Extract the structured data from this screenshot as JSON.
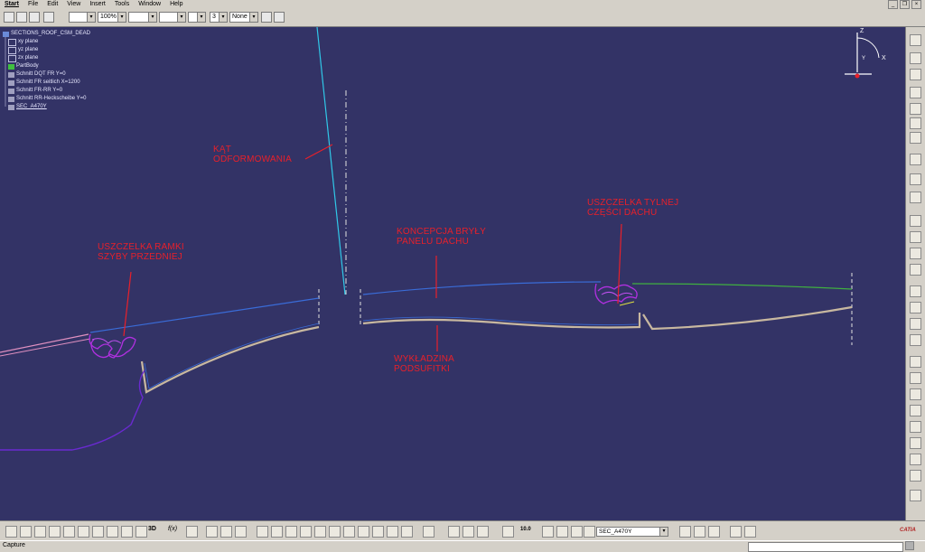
{
  "menu": [
    "Start",
    "File",
    "Edit",
    "View",
    "Insert",
    "Tools",
    "Window",
    "Help"
  ],
  "toolbar": {
    "line_style_value": "",
    "zoom_value": "100%",
    "line_type_value": "",
    "line_thickness_value": "",
    "point_style_value": "",
    "layer_number_value": "3",
    "layer_value": "None"
  },
  "tree": {
    "root": "SECTIONS_ROOF_CSM_DEAD",
    "items": [
      "xy plane",
      "yz plane",
      "zx plane",
      "PartBody",
      "Schnitt DQT FR Y=0",
      "Schnitt FR seitlich X=1200",
      "Schnitt FR-RR Y=0",
      "Schnitt RR-Heckscheibe Y=0",
      "SEC_A470Y"
    ]
  },
  "annotations": {
    "kat": [
      "KĄT",
      "ODFORMOWANIA"
    ],
    "uszczelka_ramki": [
      "USZCZELKA RAMKI",
      "SZYBY PRZEDNIEJ"
    ],
    "koncepcja": [
      "KONCEPCJA BRYŁY",
      "PANELU DACHU"
    ],
    "uszczelka_tylnej": [
      "USZCZELKA TYLNEJ",
      "CZĘŚCI DACHU"
    ],
    "wykladzina": [
      "WYKŁADZINA",
      "PODSUFITKI"
    ]
  },
  "compass": {
    "z_label": "Z",
    "x_label": "X",
    "y_label": "Y"
  },
  "bottom_toolbar": {
    "f00_label": "f(x)",
    "three_d_label": "3D",
    "section_combo_value": "SEC_A470Y",
    "scale_label": "10.0"
  },
  "status": {
    "text": "Capture",
    "input_value": ""
  },
  "brand": {
    "logo_text": "CATIA"
  },
  "colors": {
    "viewport_bg": "#333366",
    "annotation_red": "#e8202a",
    "panel_blue": "#3a6cd8",
    "seal_magenta": "#b030e0",
    "liner_tan": "#c8b8a0",
    "green_line": "#40b040",
    "cyan_line": "#30c8e8"
  }
}
